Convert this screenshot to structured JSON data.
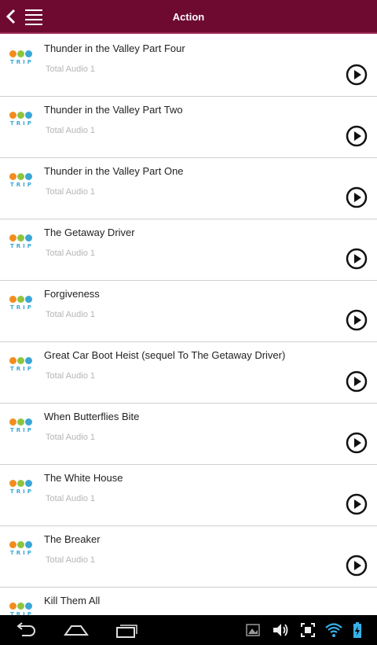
{
  "header": {
    "title": "Action"
  },
  "colors": {
    "header_bg": "#6e0a30",
    "row_divider": "#cfcfcf",
    "subtitle": "#b5b5b5"
  },
  "icons": {
    "back": "back-arrow-icon",
    "menu": "hamburger-menu-icon",
    "play": "play-circle-icon",
    "logo": "otr-trip-logo-icon"
  },
  "logo_text": "TRIP",
  "items": [
    {
      "title": "Thunder in the Valley Part Four",
      "subtitle": "Total Audio 1"
    },
    {
      "title": "Thunder in the Valley Part Two",
      "subtitle": "Total Audio 1"
    },
    {
      "title": "Thunder in the Valley Part One",
      "subtitle": "Total Audio 1"
    },
    {
      "title": "The Getaway Driver",
      "subtitle": "Total Audio 1"
    },
    {
      "title": "Forgiveness",
      "subtitle": "Total Audio 1"
    },
    {
      "title": "Great Car Boot Heist (sequel To The Getaway Driver)",
      "subtitle": "Total Audio 1"
    },
    {
      "title": "When Butterflies Bite",
      "subtitle": "Total Audio 1"
    },
    {
      "title": "The White House",
      "subtitle": "Total Audio 1"
    },
    {
      "title": "The Breaker",
      "subtitle": "Total Audio 1"
    },
    {
      "title": "Kill Them All",
      "subtitle": ""
    }
  ],
  "system_bar": {
    "icons": [
      "back-nav-icon",
      "home-nav-icon",
      "recents-nav-icon",
      "gallery-icon",
      "volume-icon",
      "screenshot-icon",
      "wifi-icon",
      "battery-charging-icon"
    ]
  }
}
